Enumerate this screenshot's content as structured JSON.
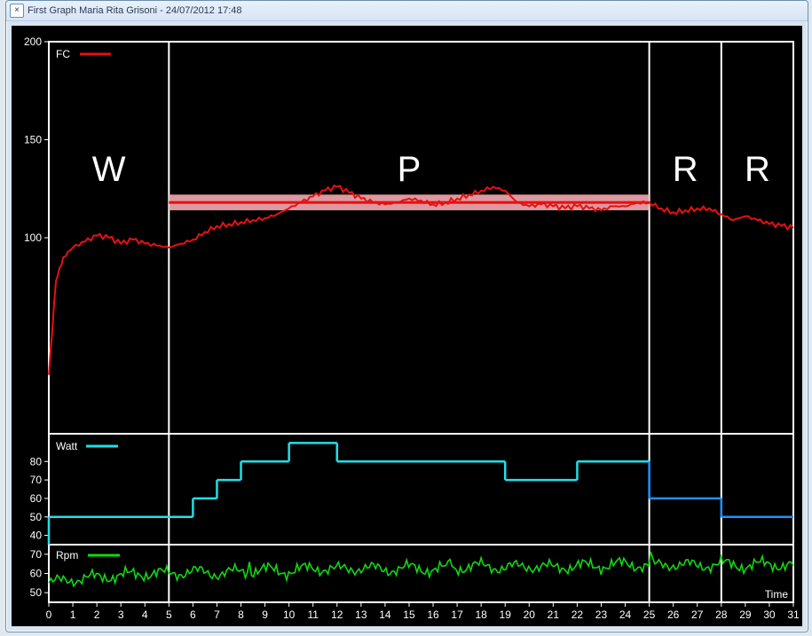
{
  "window": {
    "title": "First Graph Maria Rita Grisoni - 24/07/2012 17:48"
  },
  "phases": {
    "w": "W",
    "p": "P",
    "r1": "R",
    "r2": "R",
    "boundaries_min": [
      0,
      5,
      25,
      28,
      31
    ]
  },
  "axis": {
    "x_label": "Time",
    "x_ticks": [
      0,
      1,
      2,
      3,
      4,
      5,
      6,
      7,
      8,
      9,
      10,
      11,
      12,
      13,
      14,
      15,
      16,
      17,
      18,
      19,
      20,
      21,
      22,
      23,
      24,
      25,
      26,
      27,
      28,
      29,
      30,
      31
    ]
  },
  "chart_data": [
    {
      "id": "fc",
      "type": "line",
      "name": "FC",
      "legend": "FC",
      "color": "#e81010",
      "ylim": [
        0,
        200
      ],
      "yticks": [
        100,
        150,
        200
      ],
      "reference": {
        "value": 118,
        "band": [
          114,
          122
        ],
        "x_start": 5,
        "x_end": 25
      },
      "x": [
        0,
        0.3,
        0.6,
        1,
        1.5,
        2,
        2.5,
        3,
        3.5,
        4,
        4.5,
        5,
        5.5,
        6,
        6.5,
        7,
        7.5,
        8,
        8.5,
        9,
        9.5,
        10,
        10.5,
        11,
        11.5,
        12,
        12.5,
        13,
        13.5,
        14,
        14.5,
        15,
        15.5,
        16,
        16.5,
        17,
        17.5,
        18,
        18.5,
        19,
        19.5,
        20,
        20.5,
        21,
        21.5,
        22,
        22.5,
        23,
        23.5,
        24,
        24.5,
        25,
        25.5,
        26,
        26.5,
        27,
        27.5,
        28,
        28.5,
        29,
        29.5,
        30,
        30.5,
        31
      ],
      "y": [
        30,
        78,
        90,
        95,
        98,
        101,
        100,
        97,
        99,
        97,
        96,
        95,
        97,
        99,
        103,
        106,
        107,
        108,
        109,
        110,
        112,
        115,
        118,
        121,
        124,
        126,
        123,
        120,
        118,
        117,
        118,
        120,
        119,
        117,
        118,
        120,
        122,
        124,
        126,
        124,
        118,
        116,
        117,
        116,
        115,
        116,
        115,
        114,
        116,
        116,
        118,
        118,
        115,
        113,
        114,
        115,
        115,
        112,
        109,
        111,
        109,
        107,
        106,
        105
      ]
    },
    {
      "id": "watt",
      "type": "step",
      "name": "Watt",
      "legend": "Watt",
      "color": "#1fe0e8",
      "color_last": "#1e90ff",
      "ylim": [
        35,
        95
      ],
      "yticks": [
        40,
        50,
        60,
        70,
        80
      ],
      "steps": [
        {
          "x0": 0,
          "x1": 5,
          "y": 50
        },
        {
          "x0": 5,
          "x1": 6,
          "y": 50
        },
        {
          "x0": 6,
          "x1": 7,
          "y": 60
        },
        {
          "x0": 7,
          "x1": 8,
          "y": 70
        },
        {
          "x0": 8,
          "x1": 10,
          "y": 80
        },
        {
          "x0": 10,
          "x1": 12,
          "y": 90
        },
        {
          "x0": 12,
          "x1": 19,
          "y": 80
        },
        {
          "x0": 19,
          "x1": 22,
          "y": 70
        },
        {
          "x0": 22,
          "x1": 25,
          "y": 80
        },
        {
          "x0": 25,
          "x1": 28,
          "y": 60
        },
        {
          "x0": 28,
          "x1": 31,
          "y": 50
        }
      ]
    },
    {
      "id": "rpm",
      "type": "line",
      "name": "Rpm",
      "legend": "Rpm",
      "color": "#10d810",
      "ylim": [
        45,
        75
      ],
      "yticks": [
        50,
        60,
        70
      ],
      "x": [
        0,
        1,
        2,
        3,
        4,
        5,
        6,
        7,
        8,
        9,
        10,
        11,
        12,
        13,
        14,
        15,
        16,
        17,
        18,
        19,
        20,
        21,
        22,
        23,
        24,
        25,
        26,
        27,
        28,
        29,
        30,
        31
      ],
      "y": [
        55,
        57,
        58,
        59,
        60,
        60,
        61,
        60,
        61,
        62,
        61,
        63,
        62,
        63,
        62,
        63,
        62,
        63,
        64,
        63,
        64,
        63,
        64,
        64,
        65,
        64,
        65,
        64,
        65,
        64,
        65,
        64
      ]
    }
  ]
}
